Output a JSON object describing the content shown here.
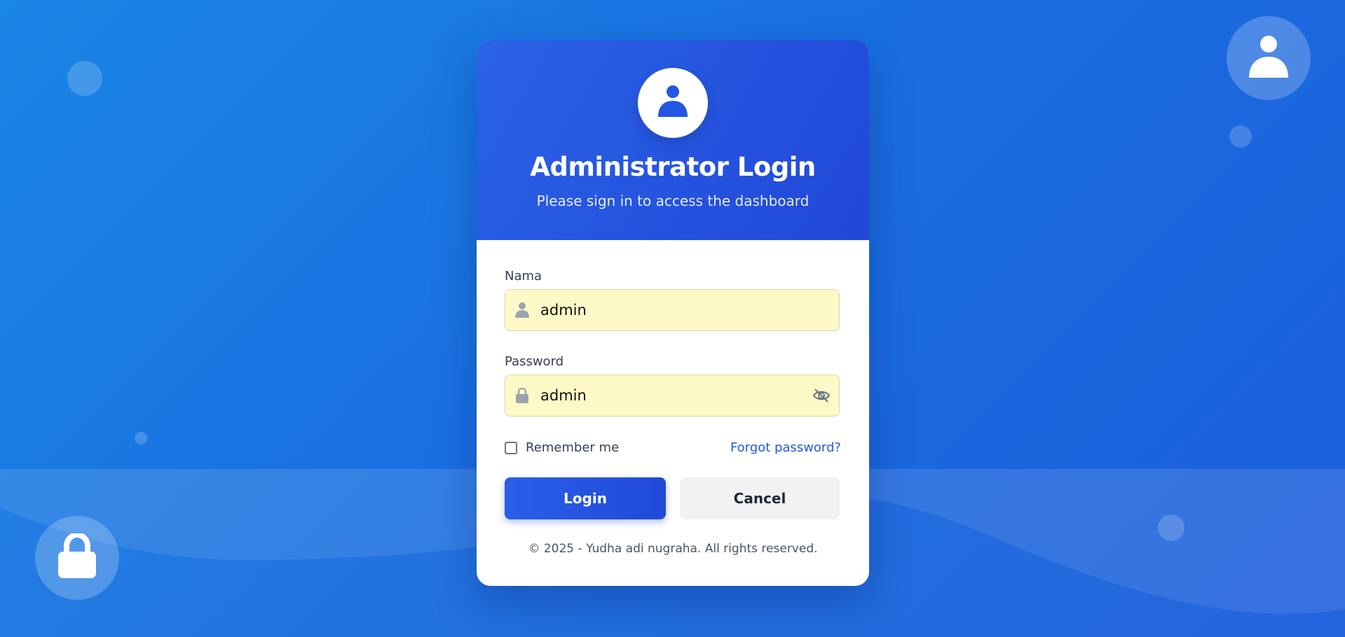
{
  "header": {
    "title": "Administrator Login",
    "subtitle": "Please sign in to access the dashboard",
    "avatar_icon": "user-icon"
  },
  "form": {
    "name_label": "Nama",
    "name_value": "admin",
    "name_icon": "user-icon",
    "password_label": "Password",
    "password_value": "admin",
    "password_icon": "lock-icon",
    "toggle_visibility_icon": "eye-slash-icon",
    "remember_label": "Remember me",
    "remember_checked": false,
    "forgot_label": "Forgot password?"
  },
  "actions": {
    "login_label": "Login",
    "cancel_label": "Cancel"
  },
  "footer": {
    "copyright": "© 2025 - Yudha adi nugraha. All rights reserved."
  },
  "decorations": {
    "top_right_icon": "user-icon",
    "bottom_left_icon": "lock-icon"
  },
  "colors": {
    "primary": "#2457e0",
    "background": "#1a6fe0",
    "field_background": "#fefac8"
  }
}
